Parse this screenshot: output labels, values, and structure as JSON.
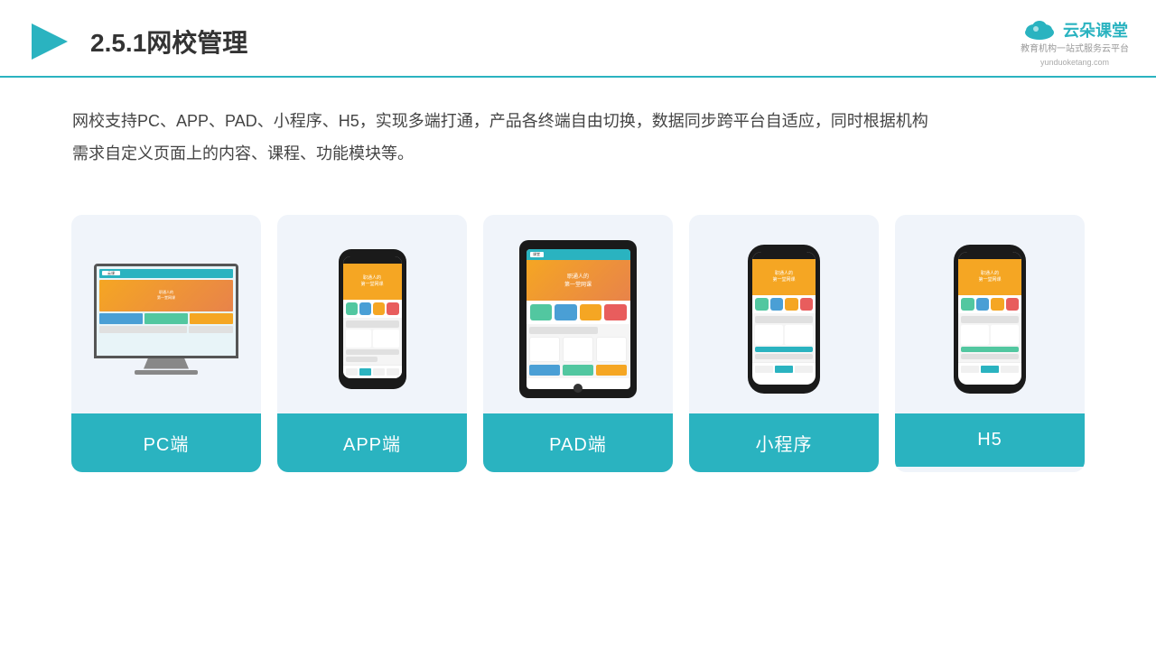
{
  "header": {
    "title": "2.5.1网校管理",
    "logo_name": "云朵课堂",
    "logo_url": "yunduoketang.com",
    "logo_tagline": "教育机构一站\n式服务云平台"
  },
  "description": {
    "text": "网校支持PC、APP、PAD、小程序、H5，实现多端打通，产品各终端自由切换，数据同步跨平台自适应，同时根据机构需求自定义页面上的内容、课程、功能模块等。"
  },
  "cards": [
    {
      "id": "pc",
      "label": "PC端",
      "type": "pc"
    },
    {
      "id": "app",
      "label": "APP端",
      "type": "phone"
    },
    {
      "id": "pad",
      "label": "PAD端",
      "type": "tablet"
    },
    {
      "id": "miniprogram",
      "label": "小程序",
      "type": "phone"
    },
    {
      "id": "h5",
      "label": "H5",
      "type": "phone"
    }
  ],
  "colors": {
    "teal": "#2ab3c0",
    "card_bg": "#f0f4fa",
    "label_bg": "#2ab3c0"
  }
}
